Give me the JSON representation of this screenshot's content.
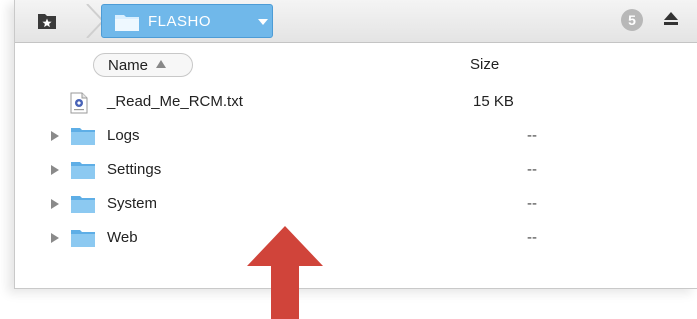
{
  "toolbar": {
    "favorites_icon": "star-folder-icon",
    "breadcrumb": {
      "label": "FLASHO",
      "icon": "folder-icon",
      "dropdown_icon": "chevron-down-icon"
    },
    "badge_count": "5",
    "eject_icon": "eject-icon"
  },
  "columns": {
    "name": "Name",
    "size": "Size",
    "sort": "ascending"
  },
  "files": [
    {
      "name": "_Read_Me_RCM.txt",
      "size": "15 KB",
      "type": "text-file",
      "expandable": false
    },
    {
      "name": "Logs",
      "size": "--",
      "type": "folder",
      "expandable": true
    },
    {
      "name": "Settings",
      "size": "--",
      "type": "folder",
      "expandable": true
    },
    {
      "name": "System",
      "size": "--",
      "type": "folder",
      "expandable": true
    },
    {
      "name": "Web",
      "size": "--",
      "type": "folder",
      "expandable": true
    }
  ],
  "colors": {
    "folder": "#7ec2ef",
    "breadcrumb_bg": "#70b8ea",
    "arrow": "#d0443a"
  }
}
